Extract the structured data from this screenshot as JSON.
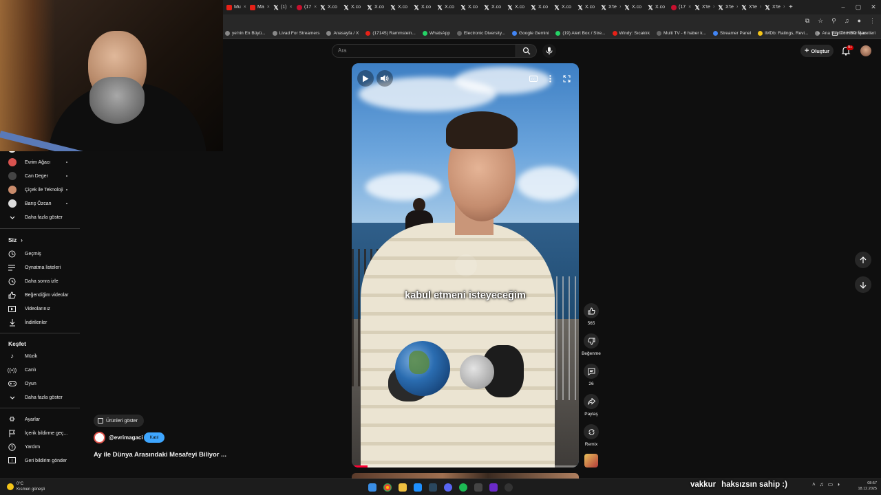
{
  "browser": {
    "tabs": [
      {
        "label": "Mu",
        "icon": "youtube-icon"
      },
      {
        "label": "Ma",
        "icon": "youtube-icon"
      },
      {
        "label": "(1) ",
        "icon": "x-icon"
      },
      {
        "label": "(17",
        "icon": "reddit-icon"
      },
      {
        "label": "X.co",
        "icon": "x-icon"
      },
      {
        "label": "X.co",
        "icon": "x-icon"
      },
      {
        "label": "X.co",
        "icon": "x-icon"
      },
      {
        "label": "X.co",
        "icon": "x-icon"
      },
      {
        "label": "X.co",
        "icon": "x-icon"
      },
      {
        "label": "X.co",
        "icon": "x-icon"
      },
      {
        "label": "X.co",
        "icon": "x-icon"
      },
      {
        "label": "X.co",
        "icon": "x-icon"
      },
      {
        "label": "X.co",
        "icon": "x-icon"
      },
      {
        "label": "X.co",
        "icon": "x-icon"
      },
      {
        "label": "X.co",
        "icon": "x-icon"
      },
      {
        "label": "X.co",
        "icon": "x-icon"
      },
      {
        "label": "X'te",
        "icon": "x-icon"
      },
      {
        "label": "X.co",
        "icon": "x-icon"
      },
      {
        "label": "X.co",
        "icon": "x-icon"
      },
      {
        "label": "(17",
        "icon": "reddit-icon"
      },
      {
        "label": "X'te",
        "icon": "x-icon"
      },
      {
        "label": "X'te",
        "icon": "x-icon"
      },
      {
        "label": "X'te",
        "icon": "x-icon"
      },
      {
        "label": "X'te",
        "icon": "x-icon"
      }
    ],
    "new_tab": "+",
    "window_controls": [
      "–",
      "▢",
      "✕"
    ],
    "bookmarks": [
      {
        "label": "ye'nin En Büyü...",
        "color": "#888888"
      },
      {
        "label": "Livad For Streamers",
        "color": "#888888"
      },
      {
        "label": "Anasayfa / X",
        "color": "#888888"
      },
      {
        "label": "(17145) Rammstein...",
        "color": "#e62117"
      },
      {
        "label": "WhatsApp",
        "color": "#25d366"
      },
      {
        "label": "Electronic Diversity...",
        "color": "#666666"
      },
      {
        "label": "Google Gemini",
        "color": "#4285f4"
      },
      {
        "label": "(19) Alert Box / Stre...",
        "color": "#25d366"
      },
      {
        "label": "Windy: Sıcaklık",
        "color": "#e62117"
      },
      {
        "label": "Multi TV - 6 haber k...",
        "color": "#666666"
      },
      {
        "label": "Streamer Panel",
        "color": "#4285f4"
      },
      {
        "label": "IMDb: Ratings, Revi...",
        "color": "#f5c518"
      },
      {
        "label": "Ana Sayfa • HBO Max",
        "color": "#888888"
      }
    ],
    "bookmarks_more": "»",
    "all_bookmarks": "Tüm Yer İşaretleri"
  },
  "youtube": {
    "search_placeholder": "Ara",
    "create_label": "Oluştur",
    "notification_badge": "9+",
    "sidebar": {
      "subscriptions": [
        {
          "name": "Evrim Ağacı",
          "color": "#d9534f"
        },
        {
          "name": "Can Deger",
          "color": "#444444"
        },
        {
          "name": "Çiçek ile Teknoloji",
          "color": "#c98b6b"
        },
        {
          "name": "Barış Özcan",
          "color": "#dddddd"
        }
      ],
      "subs_show_more": "Daha fazla göster",
      "you_header": "Siz",
      "you_items": [
        {
          "label": "Geçmiş",
          "icon": "history-icon"
        },
        {
          "label": "Oynatma listeleri",
          "icon": "playlist-icon"
        },
        {
          "label": "Daha sonra izle",
          "icon": "clock-icon"
        },
        {
          "label": "Beğendiğim videolar",
          "icon": "thumb-up-icon"
        },
        {
          "label": "Videolarınız",
          "icon": "video-icon"
        },
        {
          "label": "İndirilenler",
          "icon": "download-icon"
        }
      ],
      "explore_header": "Keşfet",
      "explore_items": [
        {
          "label": "Müzik",
          "icon": "music-icon"
        },
        {
          "label": "Canlı",
          "icon": "live-icon"
        },
        {
          "label": "Oyun",
          "icon": "gaming-icon"
        },
        {
          "label": "Daha fazla göster",
          "icon": "chevron-down-icon"
        }
      ],
      "footer_items": [
        {
          "label": "Ayarlar",
          "icon": "gear-icon"
        },
        {
          "label": "İçerik bildirme geç...",
          "icon": "flag-icon"
        },
        {
          "label": "Yardım",
          "icon": "help-icon"
        },
        {
          "label": "Geri bildirim gönder",
          "icon": "feedback-icon"
        }
      ]
    },
    "short": {
      "products_label": "Ürünleri göster",
      "channel_handle": "@evrimagaci",
      "join_label": "Katıl",
      "title": "Ay ile Dünya Arasındaki Mesafeyi Biliyor ...",
      "caption": "kabul etmeni isteyeceğim",
      "progress": 0.07,
      "actions": {
        "like_count": "565",
        "dislike_label": "Beğenme",
        "comment_count": "26",
        "share_label": "Paylaş",
        "remix_label": "Remix"
      }
    }
  },
  "chat": {
    "username": "vakkur",
    "message": "haksızsın sahip :)"
  },
  "taskbar": {
    "weather_temp": "0°C",
    "weather_desc": "Kısmen güneşli",
    "time": "08:57",
    "date": "18.12.2025"
  }
}
